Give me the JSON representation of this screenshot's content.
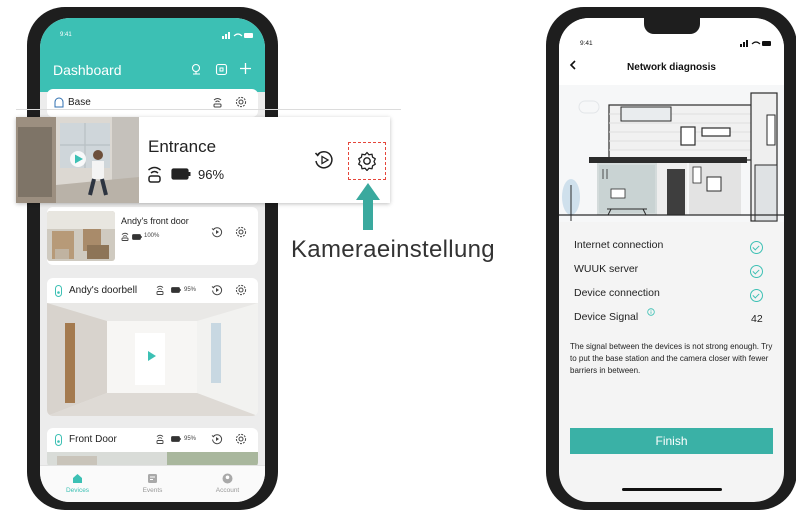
{
  "left_phone": {
    "status_time": "9:41",
    "header_title": "Dashboard",
    "base": {
      "label": "Base"
    },
    "zoom": {
      "camera_name": "Entrance",
      "battery": "96%"
    },
    "andys_front_door": {
      "name": "Andy's front door",
      "battery": "100%"
    },
    "andys_doorbell": {
      "name": "Andy's doorbell",
      "battery": "95%"
    },
    "front_door": {
      "name": "Front Door",
      "battery": "95%"
    },
    "tabs": [
      {
        "label": "Devices"
      },
      {
        "label": "Events"
      },
      {
        "label": "Account"
      }
    ]
  },
  "callout": {
    "label": "Kameraeinstellung"
  },
  "right_phone": {
    "status_time": "9:41",
    "title": "Network diagnosis",
    "rows": [
      {
        "label": "Internet connection"
      },
      {
        "label": "WUUK server"
      },
      {
        "label": "Device connection"
      },
      {
        "label": "Device Signal",
        "value": "42"
      }
    ],
    "message": "The signal between the devices is not strong enough. Try to put the base station and the camera closer with fewer barriers in between.",
    "finish_label": "Finish"
  },
  "colors": {
    "accent": "#3cc0b4",
    "callout_dash": "#e5453a"
  }
}
